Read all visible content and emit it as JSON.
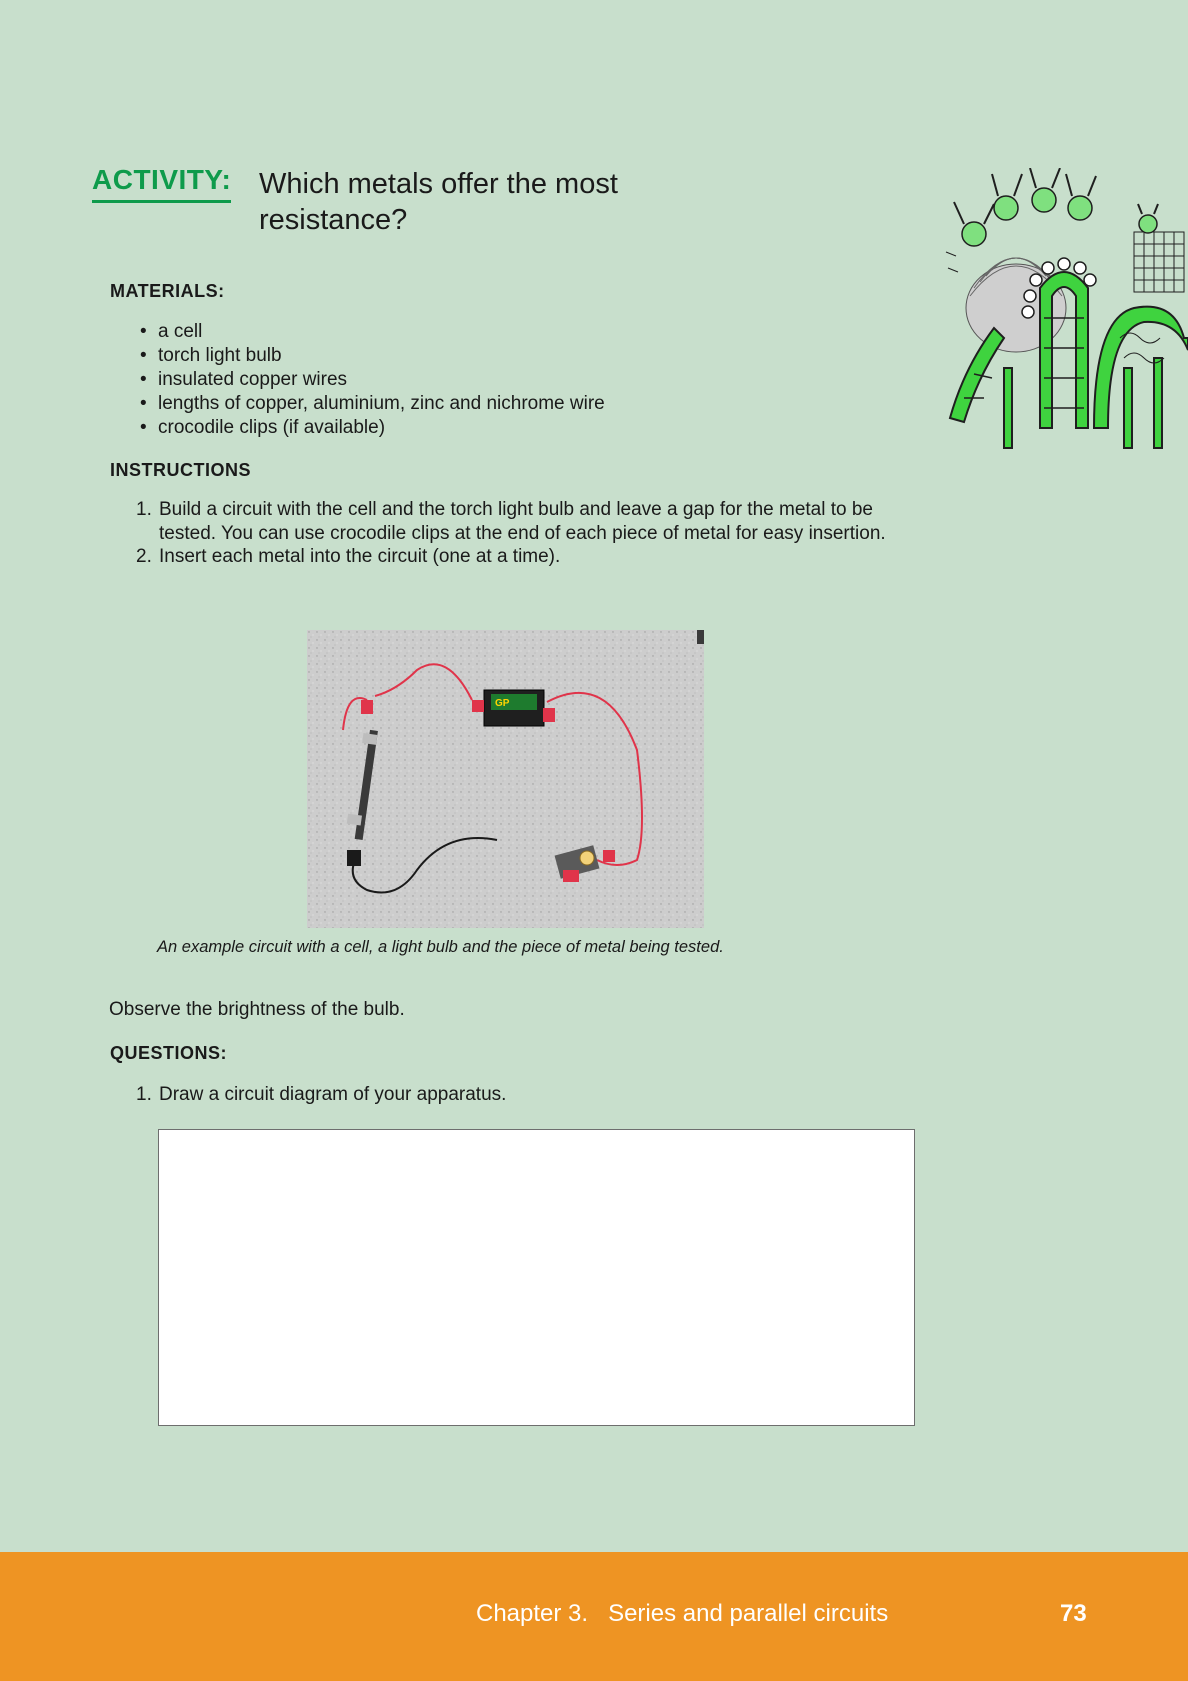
{
  "activity": {
    "label": "ACTIVITY:",
    "title": "Which metals offer the most resistance?"
  },
  "illustration": {
    "icon": "roller-coaster-illustration"
  },
  "materials": {
    "heading": "MATERIALS:",
    "items": [
      "a cell",
      "torch light bulb",
      "insulated copper wires",
      "lengths of copper, aluminium, zinc and nichrome wire",
      "crocodile clips (if available)"
    ]
  },
  "instructions": {
    "heading": "INSTRUCTIONS",
    "steps": [
      {
        "num": "1.",
        "text": "Build a circuit with the cell and the torch light bulb and leave a gap for the metal to be tested. You can use crocodile clips at the end of each piece of metal for easy insertion."
      },
      {
        "num": "2.",
        "text": "Insert each metal into the circuit (one at a time)."
      }
    ]
  },
  "figure": {
    "photo_icon": "circuit-photo",
    "battery_brand": "GP",
    "caption": "An example circuit with a cell, a light bulb and the piece of metal being tested."
  },
  "observe": "Observe the brightness of the bulb.",
  "questions": {
    "heading": "QUESTIONS:",
    "items": [
      {
        "num": "1.",
        "text": "Draw a circuit diagram of your apparatus."
      }
    ]
  },
  "footer": {
    "chapter": "Chapter 3.   Series and parallel circuits",
    "page_number": "73",
    "color": "#ee9423"
  },
  "colors": {
    "background": "#c8dfcc",
    "accent": "#0e9b4b"
  }
}
